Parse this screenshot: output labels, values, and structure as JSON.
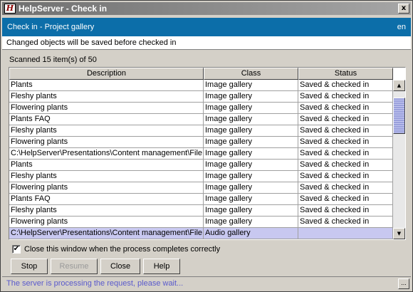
{
  "window": {
    "title": "HelpServer - Check in",
    "app_icon_glyph": "H",
    "close_glyph": "x"
  },
  "header": {
    "title": "Check in - Project gallery",
    "language": "en",
    "background": "#0c6ea9"
  },
  "info": {
    "message": "Changed objects will be saved before checked in"
  },
  "scan": {
    "label": "Scanned 15 item(s) of 50"
  },
  "table": {
    "columns": [
      "Description",
      "Class",
      "Status"
    ],
    "rows": [
      [
        "Plants",
        "Image gallery",
        "Saved & checked in"
      ],
      [
        "Fleshy plants",
        "Image gallery",
        "Saved & checked in"
      ],
      [
        "Flowering plants",
        "Image gallery",
        "Saved & checked in"
      ],
      [
        "Plants FAQ",
        "Image gallery",
        "Saved & checked in"
      ],
      [
        "Fleshy plants",
        "Image gallery",
        "Saved & checked in"
      ],
      [
        "Flowering plants",
        "Image gallery",
        "Saved & checked in"
      ],
      [
        "C:\\HelpServer\\Presentations\\Content management\\File...",
        "Image gallery",
        "Saved & checked in"
      ],
      [
        "Plants",
        "Image gallery",
        "Saved & checked in"
      ],
      [
        "Fleshy plants",
        "Image gallery",
        "Saved & checked in"
      ],
      [
        "Flowering plants",
        "Image gallery",
        "Saved & checked in"
      ],
      [
        "Plants FAQ",
        "Image gallery",
        "Saved & checked in"
      ],
      [
        "Fleshy plants",
        "Image gallery",
        "Saved & checked in"
      ],
      [
        "Flowering plants",
        "Image gallery",
        "Saved & checked in"
      ],
      [
        "C:\\HelpServer\\Presentations\\Content management\\File...",
        "Audio gallery",
        ""
      ]
    ],
    "selected_row": 13,
    "selected_color": "#c8c8f0"
  },
  "checkbox": {
    "label": "Close this window when the process completes correctly",
    "checked": true,
    "check_glyph": "✔"
  },
  "buttons": {
    "stop": "Stop",
    "resume": "Resume",
    "close": "Close",
    "help": "Help"
  },
  "status": {
    "text": "The server is processing the request, please wait...",
    "button_label": "...",
    "text_color": "#5a5acc"
  }
}
